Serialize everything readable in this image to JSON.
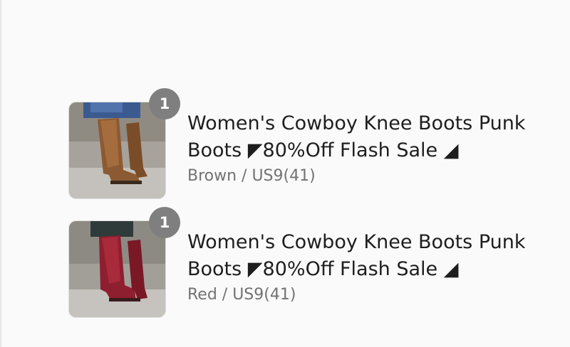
{
  "order_summary": {
    "items": [
      {
        "quantity": "1",
        "title": "Women's Cowboy Knee Boots Punk Boots ◤80%Off Flash Sale ◢",
        "variant": "Brown / US9(41)",
        "image_icon": "brown-boot-image"
      },
      {
        "quantity": "1",
        "title": "Women's Cowboy Knee Boots Punk Boots ◤80%Off Flash Sale ◢",
        "variant": "Red / US9(41)",
        "image_icon": "red-boot-image"
      }
    ]
  },
  "colors": {
    "badge_bg": "#7f7f7f",
    "title_text": "#1e1e1e",
    "variant_text": "#727272",
    "page_bg": "#fafafa"
  }
}
